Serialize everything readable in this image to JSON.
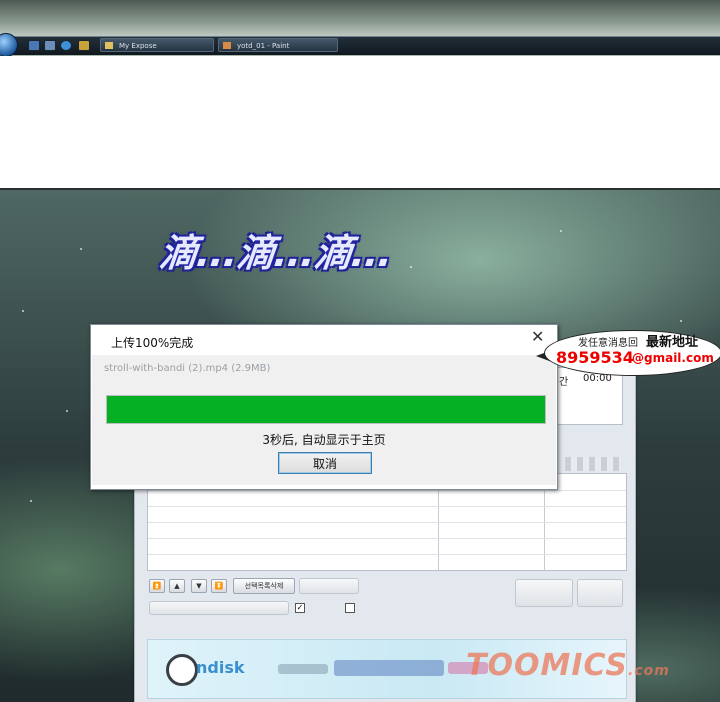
{
  "taskbar": {
    "items": [
      {
        "label": "My Expose",
        "icon": "folder-icon"
      },
      {
        "label": "yotd_01 - Paint",
        "icon": "paint-icon"
      }
    ]
  },
  "comic": {
    "sound_effect": "滴...滴...滴..."
  },
  "dialog": {
    "title": "上传100%完成",
    "filename": "stroll-with-bandi (2).mp4 (2.9MB)",
    "progress": 1.0,
    "status": "3秒后, 自动显示于主页",
    "cancel_label": "取消",
    "progress_color": "#06b025"
  },
  "background_app": {
    "time_label": "간",
    "time_value": "00:00",
    "delete_selected_label": "선택목록삭제",
    "banner_logo": "ndisk",
    "nav_buttons": [
      "⏫",
      "▲",
      "▼",
      "⏬"
    ]
  },
  "watermark": {
    "line1_small": "发任意消息回",
    "line1_big": "最新地址",
    "number": "8959534",
    "email": "@gmail.com",
    "brand": "TOOMICS",
    "brand_suffix": ".com"
  }
}
